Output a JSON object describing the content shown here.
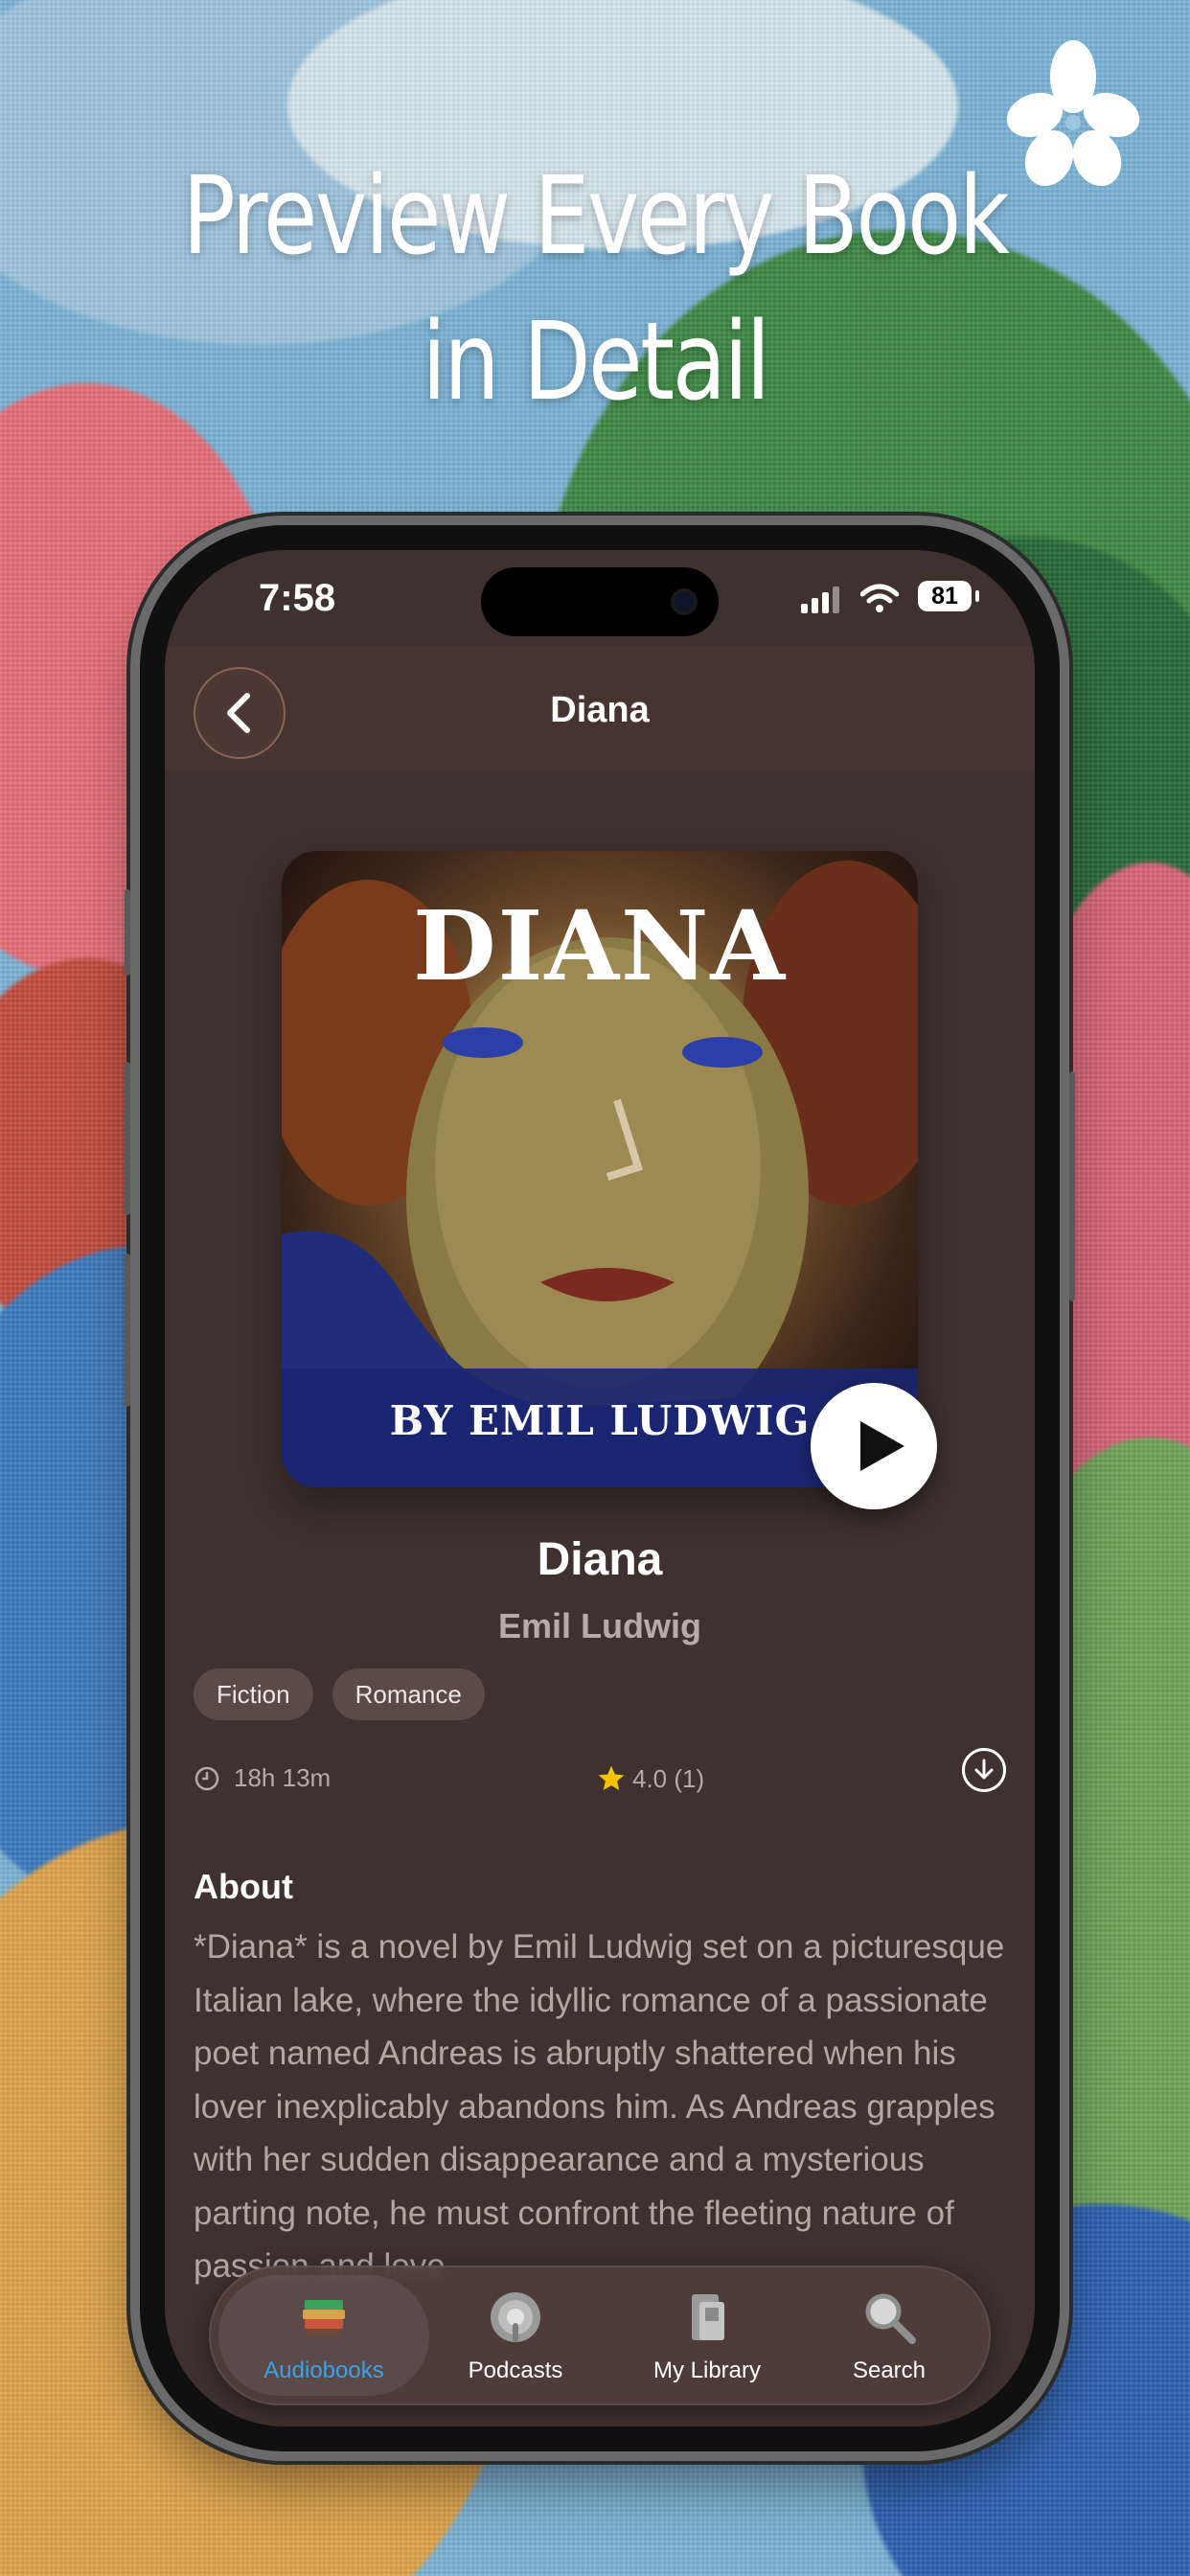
{
  "headline": {
    "line1": "Preview Every Book",
    "line2": "in Detail"
  },
  "status_bar": {
    "time": "7:58",
    "battery": "81"
  },
  "nav": {
    "title": "Diana"
  },
  "cover": {
    "title": "DIANA",
    "author": "BY EMIL LUDWIG"
  },
  "book": {
    "title": "Diana",
    "author": "Emil Ludwig",
    "tags": [
      "Fiction",
      "Romance"
    ],
    "duration": "18h 13m",
    "rating": "4.0 (1)"
  },
  "about": {
    "heading": "About",
    "text": "*Diana* is a novel by Emil Ludwig set on a picturesque Italian lake, where the idyllic romance of a passionate poet named Andreas is abruptly shattered when his lover inexplicably abandons him. As Andreas grapples with her sudden disappearance and a mysterious parting note, he must confront the fleeting nature of passion and love."
  },
  "tabbar": {
    "items": [
      {
        "label": "Audiobooks",
        "icon": "audiobooks-icon",
        "active": true
      },
      {
        "label": "Podcasts",
        "icon": "podcasts-icon",
        "active": false
      },
      {
        "label": "My Library",
        "icon": "library-icon",
        "active": false
      },
      {
        "label": "Search",
        "icon": "search-icon",
        "active": false
      }
    ]
  },
  "colors": {
    "accent": "#3aa2e6",
    "screen_bg": "#3f312d",
    "star": "#f5c400"
  }
}
